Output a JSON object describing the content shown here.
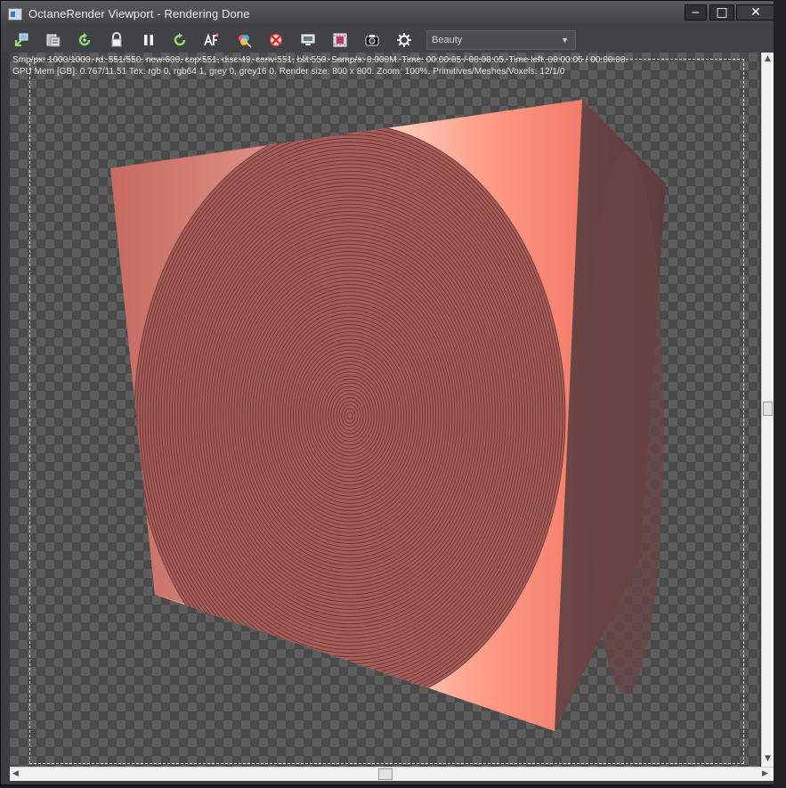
{
  "window": {
    "title": "OctaneRender Viewport - Rendering Done",
    "controls": {
      "minimize": "‒",
      "maximize": "□",
      "close": "✕"
    }
  },
  "toolbar": {
    "icons": [
      "recenter-view-icon",
      "copy-to-clipboard-icon",
      "reset-camera-icon",
      "lock-viewport-icon",
      "pause-render-icon",
      "restart-render-icon",
      "auto-focus-icon",
      "color-picker-icon",
      "clear-picker-icon",
      "display-settings-icon",
      "film-settings-icon",
      "snapshot-icon",
      "settings-icon"
    ],
    "render_pass": {
      "selected": "Beauty"
    }
  },
  "stats": {
    "line1": "Smp/px: 1000/1000.   rd: 551/550.   new:600, cop:551, disc:49, conv:551, blit:550.   Samp/s: 0.000M.   Time: 00:00:05 / 00:00:05.   Time left: 00:00:05 / 00:00:00.",
    "line2": "GPU Mem [GB]: 0.767/11.51   Tex: rgb 0, rgb64 1, grey 0, grey16 0.   Render size: 800 x 800.   Zoom: 100%.   Primitives/Meshes/Voxels: 12/1/0"
  },
  "colors": {
    "cube_left": "#c46a62",
    "cube_front_light": "#ffd9c8",
    "cube_front_mid": "#ff8f7a",
    "cube_right": "#7d4c4b",
    "disc": "#a85c58",
    "ring_line": "#5a2f30"
  }
}
